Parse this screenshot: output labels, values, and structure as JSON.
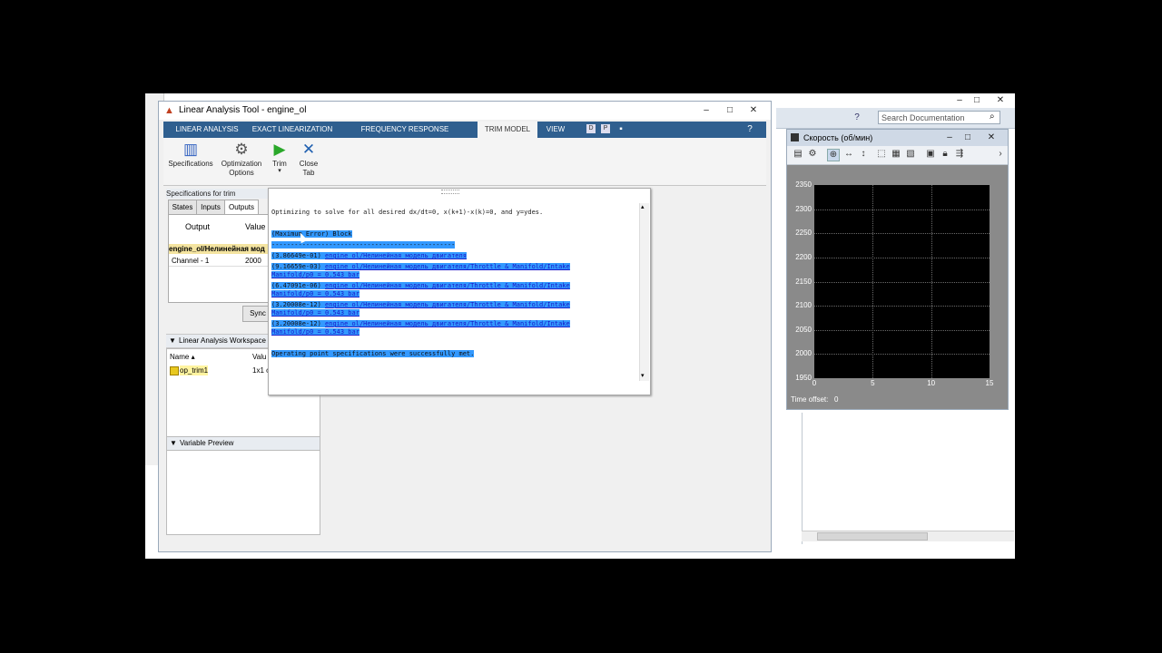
{
  "app": {
    "title": "Linear Analysis Tool - engine_ol",
    "window_controls": [
      "–",
      "□",
      "✕"
    ]
  },
  "ribbon": {
    "tabs": [
      {
        "label": "LINEAR ANALYSIS"
      },
      {
        "label": "EXACT LINEARIZATION"
      },
      {
        "label": "FREQUENCY RESPONSE ESTIMATION"
      },
      {
        "label": "TRIM MODEL"
      },
      {
        "label": "VIEW"
      }
    ],
    "buttons": [
      {
        "label": "Specifications",
        "icon": "specifications-icon"
      },
      {
        "label": "Optimization\nOptions",
        "icon": "gear-icon"
      },
      {
        "label": "Trim",
        "icon": "play-icon"
      },
      {
        "label": "Close\nTab",
        "icon": "close-icon"
      }
    ],
    "trim_arrow": "▾"
  },
  "specs": {
    "header": "Specifications for trim",
    "tabs": [
      "States",
      "Inputs",
      "Outputs"
    ],
    "columns": [
      "Output",
      "Value"
    ],
    "block_row": "engine_ol/Нелинейная мод",
    "rows": [
      {
        "name": "Channel - 1",
        "value": "2000"
      }
    ],
    "sync_label": "Sync"
  },
  "workspace": {
    "header": "Linear Analysis Workspace",
    "columns": [
      "Name ▴",
      "Valu"
    ],
    "rows": [
      {
        "name": "op_trim1",
        "value": "1x1 o"
      }
    ]
  },
  "variable_preview": {
    "header": "Variable Preview"
  },
  "dialog": {
    "lines": [
      {
        "text": "Optimizing to solve for all desired dx/dt=0, x(k+1)-x(k)=0, and y=ydes."
      },
      {
        "text": "(Maximum Error) Block"
      },
      {
        "text": "------------------------------------------------"
      },
      {
        "val": "(3.86649e-01)",
        "link": "engine_ol/Нелинейная модель двигателя"
      },
      {
        "val": "(9.16659e-03)",
        "link": "engine_ol/Нелинейная модель двигателя/Throttle & Manifold/Intake"
      },
      {
        "text": "Manifold/p0 = 0.543 bar"
      },
      {
        "val": "(6.47091e-06)",
        "link": "engine_ol/Нелинейная модель двигателя/Throttle & Manifold/Intake"
      },
      {
        "text": "Manifold/p0 = 0.543 bar"
      },
      {
        "val": "(3.20008e-12)",
        "link": "engine_ol/Нелинейная модель двигателя/Throttle & Manifold/Intake"
      },
      {
        "text": "Manifold/p0 = 0.543 bar"
      },
      {
        "val": "(3.20008e-12)",
        "link": "engine_ol/Нелинейная модель двигателя/Throttle & Manifold/Intake"
      },
      {
        "text": "Manifold/p0 = 0.543 bar"
      },
      {
        "text": "Operating point specifications were successfully met."
      }
    ]
  },
  "background": {
    "search_placeholder": "Search Documentation",
    "controls": [
      "–",
      "□",
      "✕"
    ]
  },
  "figure": {
    "title": "Скорость (об/мин)",
    "time_offset_label": "Time offset:",
    "time_offset_value": "0",
    "plot_bg": "#000000"
  },
  "chart_data": {
    "type": "line",
    "xlim": [
      0,
      15
    ],
    "ylim": [
      1950,
      2350
    ],
    "xticks": [
      "0",
      "5",
      "10",
      "15"
    ],
    "yticks": [
      "2350",
      "2300",
      "2250",
      "2200",
      "2150",
      "2100",
      "2050",
      "2000",
      "1950"
    ],
    "grid": true,
    "series": []
  },
  "colors": {
    "ribbon_blue": "#2f5f8f",
    "selection": "#3399ff",
    "link": "#1a1ac8"
  }
}
